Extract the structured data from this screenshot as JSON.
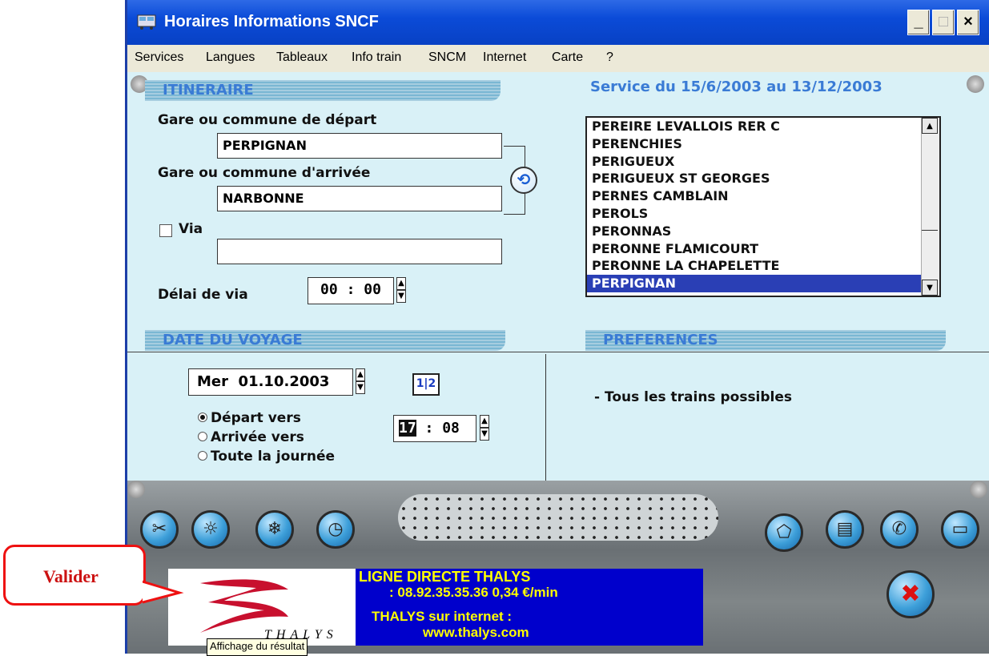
{
  "window": {
    "title": "Horaires Informations SNCF",
    "minimize": "_",
    "maximize": "□",
    "close": "×"
  },
  "menu": [
    "Services",
    "Langues",
    "Tableaux",
    "Info train",
    "SNCM",
    "Internet",
    "Carte",
    "?"
  ],
  "itineraire": {
    "header": "ITINERAIRE",
    "service_period": "Service du 15/6/2003 au 13/12/2003",
    "depart_label": "Gare ou commune de départ",
    "depart_value": "PERPIGNAN",
    "arrivee_label": "Gare ou commune d'arrivée",
    "arrivee_value": "NARBONNE",
    "via_label": "Via",
    "via_checked": false,
    "via_value": "",
    "delai_label": "Délai de via",
    "delai_hours": "00",
    "delai_minutes": "00",
    "station_list": [
      "PEREIRE LEVALLOIS RER C",
      "PERENCHIES",
      "PERIGUEUX",
      "PERIGUEUX ST GEORGES",
      "PERNES CAMBLAIN",
      "PEROLS",
      "PERONNAS",
      "PERONNE FLAMICOURT",
      "PERONNE LA CHAPELETTE",
      "PERPIGNAN"
    ],
    "selected_station": "PERPIGNAN"
  },
  "date_voyage": {
    "header": "DATE DU VOYAGE",
    "day": "Mer",
    "date": "01.10.2003",
    "calendar_icon": "1|2",
    "options": [
      "Départ vers",
      "Arrivée vers",
      "Toute la journée"
    ],
    "selected_option": "Départ vers",
    "hour": "17",
    "minute": "08"
  },
  "preferences": {
    "header": "PREFERENCES",
    "text": "- Tous les trains possibles"
  },
  "banner": {
    "line1": "LIGNE DIRECTE THALYS",
    "line2": ": 08.92.35.35.36 0,34 €/min",
    "line3": "THALYS sur internet :",
    "line4": "www.thalys.com",
    "logo_text": "THALYS"
  },
  "callout": "Valider",
  "tooltip": "Affichage du résultat",
  "colors": {
    "title_bar": "#0b4bd8",
    "panel": "#d9f1f7",
    "selection": "#2a3fb5",
    "banner": "#0000cc",
    "callout": "#ee1111"
  }
}
